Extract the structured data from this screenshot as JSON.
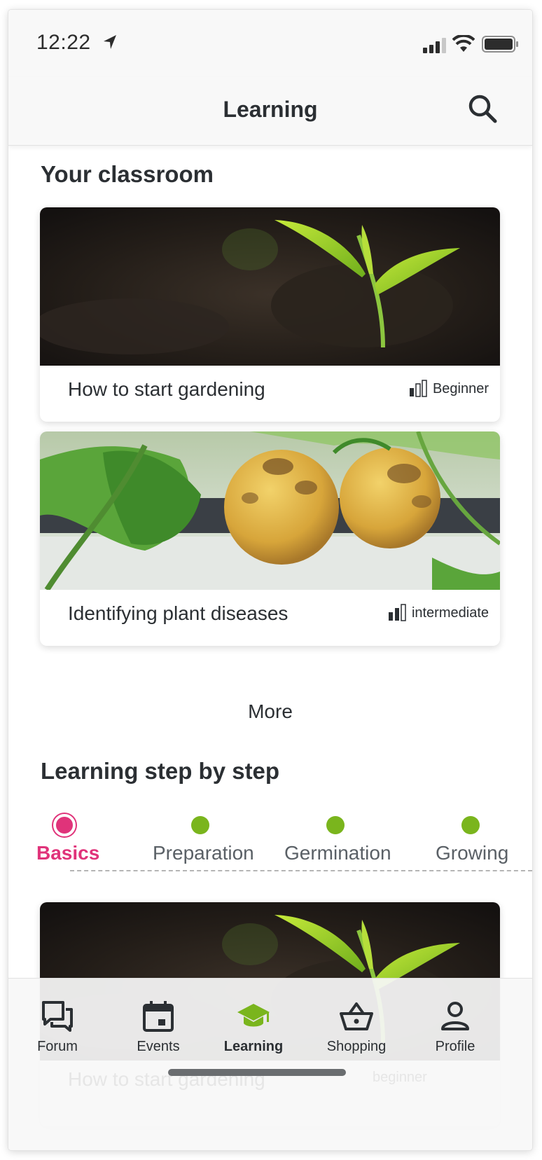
{
  "status_bar": {
    "time": "12:22"
  },
  "nav": {
    "title": "Learning"
  },
  "classroom": {
    "title": "Your classroom",
    "courses": [
      {
        "title": "How to start gardening",
        "level": "Beginner"
      },
      {
        "title": "Identifying plant diseases",
        "level": "intermediate"
      }
    ],
    "more_label": "More"
  },
  "steps": {
    "title": "Learning step by step",
    "items": [
      {
        "label": "Basics",
        "active": true
      },
      {
        "label": "Preparation",
        "active": false
      },
      {
        "label": "Germination",
        "active": false
      },
      {
        "label": "Growing",
        "active": false
      }
    ],
    "featured": {
      "title": "How to start gardening",
      "level": "beginner"
    }
  },
  "tabs": [
    {
      "label": "Forum",
      "icon": "chat-bubbles-icon"
    },
    {
      "label": "Events",
      "icon": "calendar-icon"
    },
    {
      "label": "Learning",
      "icon": "graduation-cap-icon",
      "active": true
    },
    {
      "label": "Shopping",
      "icon": "basket-icon"
    },
    {
      "label": "Profile",
      "icon": "person-icon"
    }
  ],
  "colors": {
    "accent_green": "#7ab51d",
    "active_pink": "#e0337a",
    "text": "#2b2f33"
  }
}
